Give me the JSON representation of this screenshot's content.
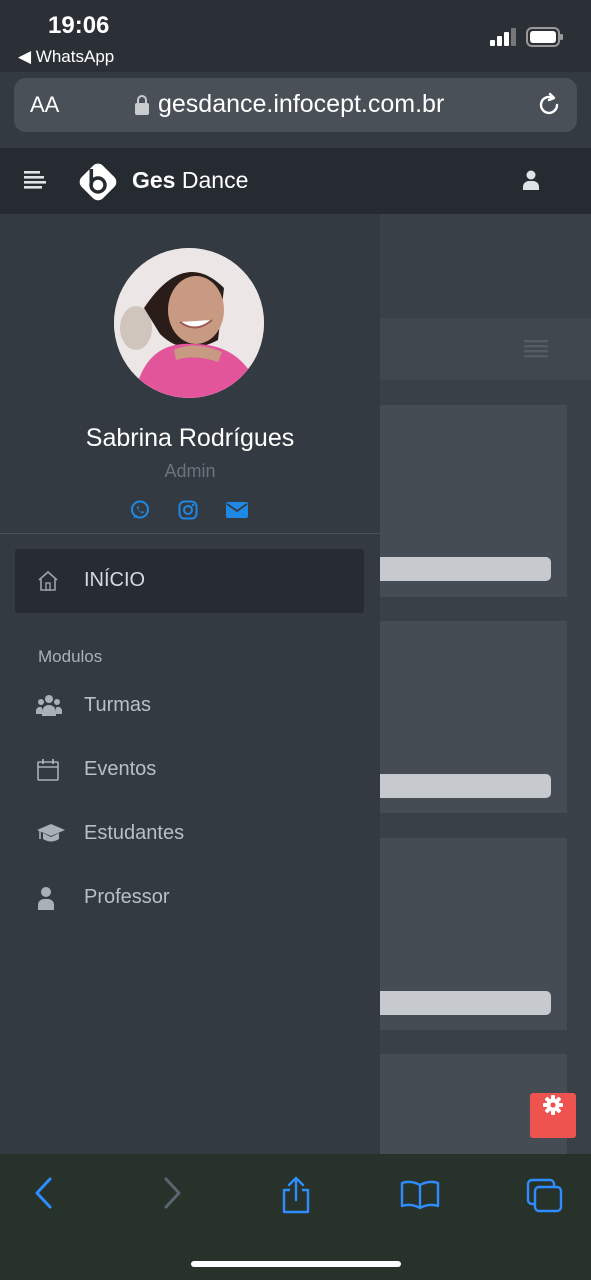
{
  "status": {
    "time": "19:06",
    "back_app": "WhatsApp"
  },
  "browser": {
    "aa": "AA",
    "url": "gesdance.infocept.com.br"
  },
  "app": {
    "brand_bold": "Ges",
    "brand_rest": "Dance"
  },
  "profile": {
    "name": "Sabrina Rodrígues",
    "role": "Admin"
  },
  "nav": {
    "active_label": "INÍCIO",
    "section_label": "Modulos",
    "items": [
      {
        "label": "Turmas",
        "icon": "users-icon"
      },
      {
        "label": "Eventos",
        "icon": "calendar-icon"
      },
      {
        "label": "Estudantes",
        "icon": "graduation-cap-icon"
      },
      {
        "label": "Professor",
        "icon": "user-icon"
      }
    ]
  },
  "colors": {
    "accent": "#1e88e5",
    "header": "#262b31",
    "sidebar": "#343a41",
    "gear": "#ef5350"
  }
}
